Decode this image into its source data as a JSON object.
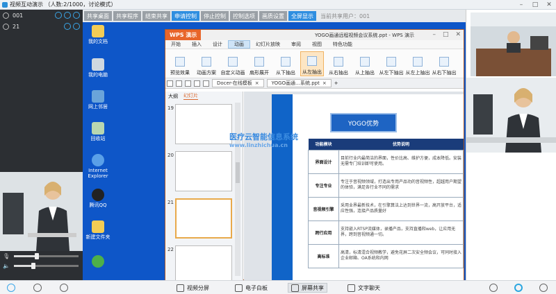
{
  "window": {
    "title": "视频互动演示 （人数:2/1000，讨论模式）"
  },
  "users": [
    {
      "name": "001"
    },
    {
      "name": "21"
    }
  ],
  "toolbar": {
    "buttons": [
      "共享桌面",
      "共享程序",
      "结束共享",
      "申请控制",
      "停止控制",
      "控制选项",
      "画质设置",
      "全屏显示"
    ],
    "active": "申请控制",
    "current_user": "当前共享用户：001"
  },
  "desktop_icons": [
    "我的文档",
    "我的电脑",
    "网上邻居",
    "回收站",
    "Internet Explorer",
    "腾讯QQ",
    "新建文件夹"
  ],
  "wps": {
    "logo": "WPS 演示",
    "doc_title": "YOGO画通远程视频会议系统.ppt - WPS 演示",
    "menu": [
      "开始",
      "插入",
      "设计",
      "动画",
      "幻灯片放映",
      "审阅",
      "视图",
      "特色功能"
    ],
    "menu_selected": "动画",
    "ribbon": [
      "预览效果",
      "动画方案",
      "自定义动画",
      "扇形展开",
      "从下抽出",
      "从左抽出",
      "从右抽出",
      "从上抽出",
      "从左下抽出",
      "从左上抽出",
      "从右下抽出"
    ],
    "ribbon_selected": "从左抽出",
    "tabs": [
      "Docer-在线模板",
      "YOGO画通…系统.ppt"
    ],
    "panel_tabs": [
      "大纲",
      "幻灯片"
    ],
    "slide_numbers": [
      "19",
      "20",
      "21",
      "22"
    ],
    "slide": {
      "heading": "YOGO优势",
      "col1": "功能模块",
      "col2": "优势说明",
      "rows": [
        {
          "k": "界面设计",
          "v": "目前行业内最简洁的界面，性价比高、维护方便，成本降低。安装无需专门培训即可使用。"
        },
        {
          "k": "专注专业",
          "v": "专注于音视频领域，打造出专用产品功的音视频性，超越用户期望的体验，满足各行业不同的需求"
        },
        {
          "k": "音视频引擎",
          "v": "采用业界最新技术，在引擎算法上达到世界一流，高开放平台，适应性强，连接产品质量好"
        },
        {
          "k": "跨行应用",
          "v": "支持嵌入RTSP流媒体，录播产品，支持直播和web，让应用无界，跨到音视频通一切。"
        },
        {
          "k": "高标准",
          "v": "高清，标清混合视频教学，避免花屏二次安全频会议，可同时接入企业邮箱、OA系统和内网"
        }
      ]
    }
  },
  "watermark": {
    "line1": "医疗云智能信息系统",
    "line2": "www.linzhichua.cn"
  },
  "bottom": {
    "buttons": [
      "视频分屏",
      "电子白板",
      "屏幕共享",
      "文字聊天"
    ],
    "selected": "屏幕共享"
  },
  "colors": {
    "accent": "#2f8ee0",
    "wps_orange": "#e8652a",
    "desktop_blue": "#0e56c8",
    "slide_blue": "#1064c8"
  },
  "volume": {
    "microphone": 0.35,
    "speaker": 0.3
  }
}
